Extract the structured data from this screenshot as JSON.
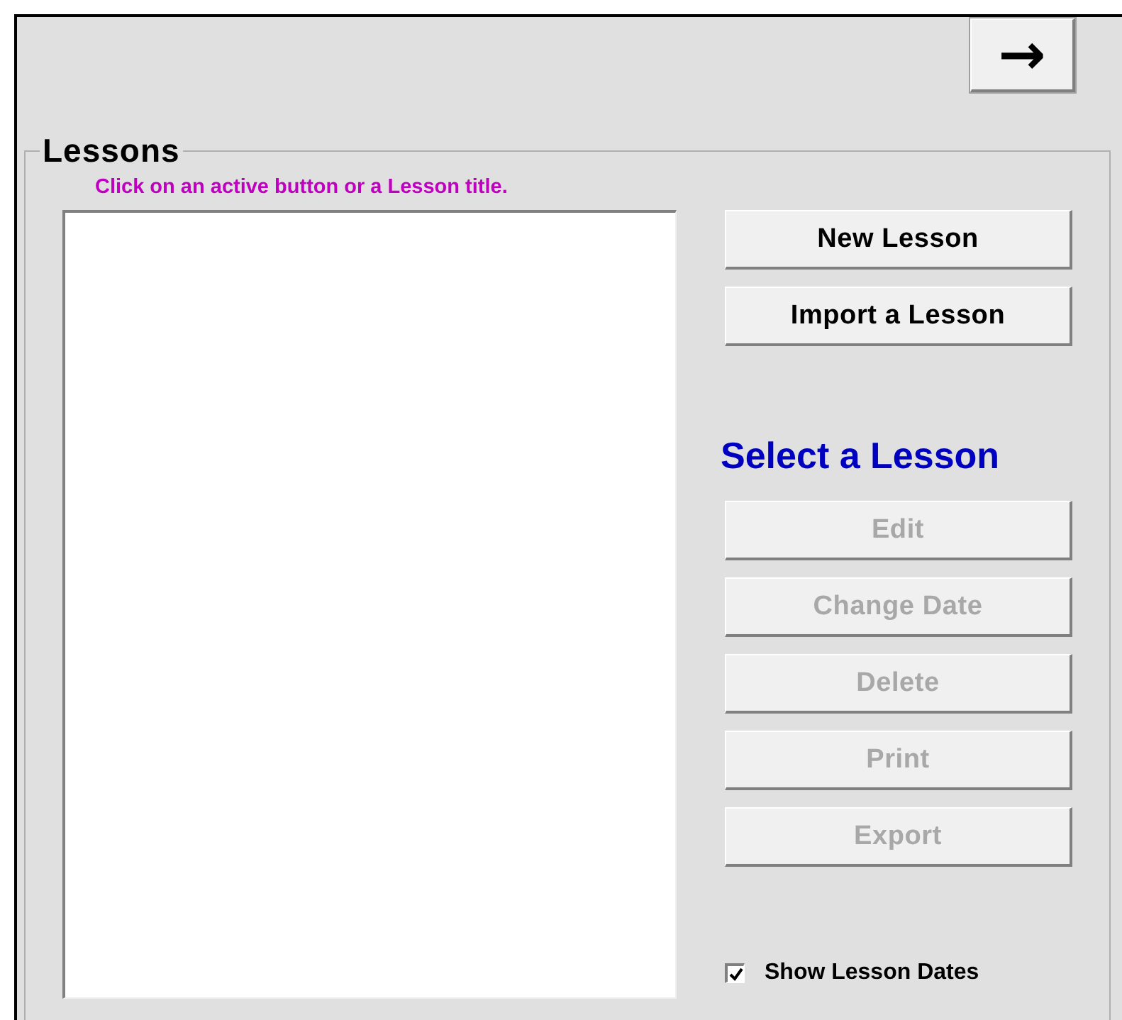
{
  "next_button": {
    "label": "→"
  },
  "group": {
    "title": "Lessons",
    "hint": "Click on an active button or a Lesson title."
  },
  "top_buttons": [
    {
      "label": "New Lesson",
      "disabled": false
    },
    {
      "label": "Import a Lesson",
      "disabled": false
    }
  ],
  "select_heading": "Select a Lesson",
  "lesson_buttons": [
    {
      "label": "Edit",
      "disabled": true
    },
    {
      "label": "Change Date",
      "disabled": true
    },
    {
      "label": "Delete",
      "disabled": true
    },
    {
      "label": "Print",
      "disabled": true
    },
    {
      "label": "Export",
      "disabled": true
    }
  ],
  "show_dates": {
    "label": "Show Lesson Dates",
    "checked": true
  }
}
